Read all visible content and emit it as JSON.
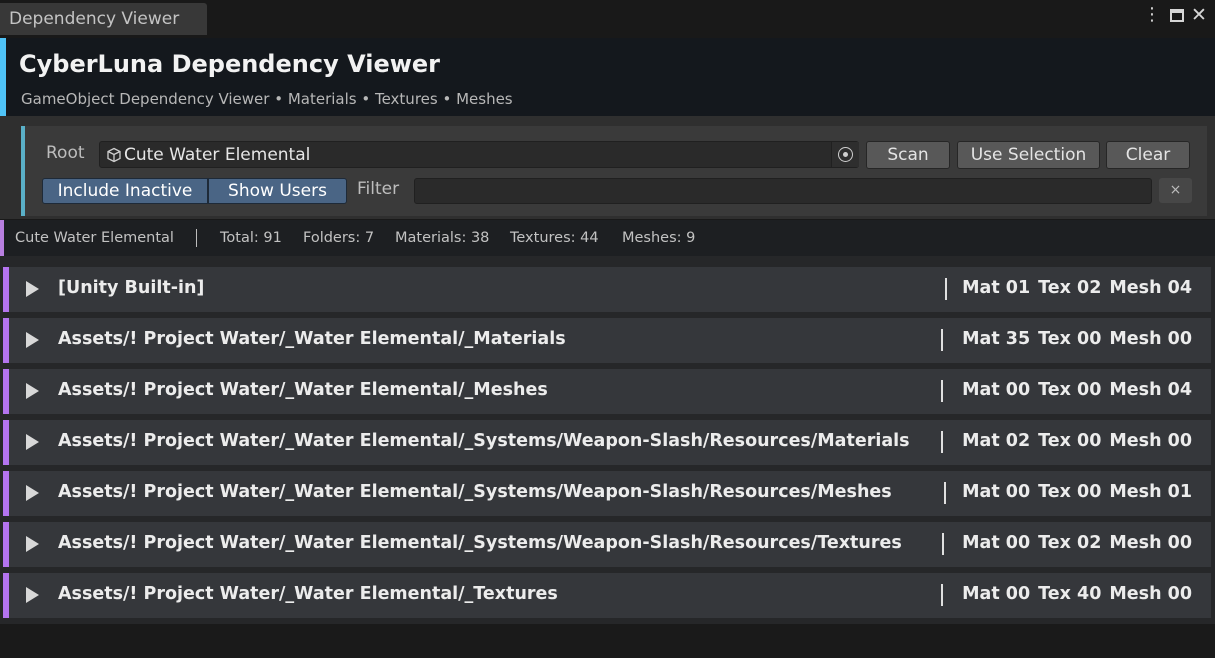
{
  "window": {
    "tab_title": "Dependency Viewer"
  },
  "header": {
    "title": "CyberLuna Dependency Viewer",
    "subtitle": "GameObject Dependency Viewer • Materials • Textures • Meshes",
    "accent_color": "#4fc3f7"
  },
  "controls": {
    "root_label": "Root",
    "root_value": "Cute Water Elemental",
    "scan_label": "Scan",
    "use_selection_label": "Use Selection",
    "clear_label": "Clear",
    "include_inactive_label": "Include Inactive",
    "show_users_label": "Show Users",
    "filter_label": "Filter",
    "filter_value": "",
    "filter_clear_glyph": "×",
    "toggle_color": "#4a6585"
  },
  "summary": {
    "root_name": "Cute Water Elemental",
    "total": "Total: 91",
    "folders": "Folders: 7",
    "materials": "Materials: 38",
    "textures": "Textures: 44",
    "meshes": "Meshes: 9"
  },
  "folders": [
    {
      "path": "[Unity Built-in]",
      "mat": "Mat 01",
      "tex": "Tex 02",
      "mesh": "Mesh 04"
    },
    {
      "path": "Assets/! Project Water/_Water Elemental/_Materials",
      "mat": "Mat 35",
      "tex": "Tex 00",
      "mesh": "Mesh 00"
    },
    {
      "path": "Assets/! Project Water/_Water Elemental/_Meshes",
      "mat": "Mat 00",
      "tex": "Tex 00",
      "mesh": "Mesh 04"
    },
    {
      "path": "Assets/! Project Water/_Water Elemental/_Systems/Weapon-Slash/Resources/Materials",
      "mat": "Mat 02",
      "tex": "Tex 00",
      "mesh": "Mesh 00"
    },
    {
      "path": "Assets/! Project Water/_Water Elemental/_Systems/Weapon-Slash/Resources/Meshes",
      "mat": "Mat 00",
      "tex": "Tex 00",
      "mesh": "Mesh 01"
    },
    {
      "path": "Assets/! Project Water/_Water Elemental/_Systems/Weapon-Slash/Resources/Textures",
      "mat": "Mat 00",
      "tex": "Tex 02",
      "mesh": "Mesh 00"
    },
    {
      "path": "Assets/! Project Water/_Water Elemental/_Textures",
      "mat": "Mat 00",
      "tex": "Tex 40",
      "mesh": "Mesh 00"
    }
  ],
  "colors": {
    "folder_accent": "#b474f0",
    "summary_accent": "#b87fe0"
  }
}
